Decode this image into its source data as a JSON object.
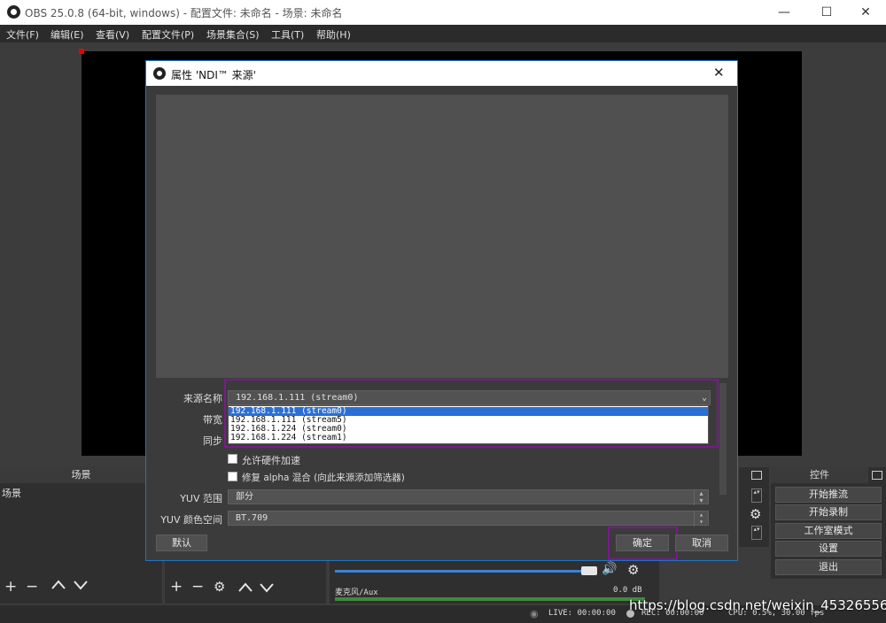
{
  "window": {
    "title": "OBS 25.0.8 (64-bit, windows) - 配置文件: 未命名 - 场景: 未命名",
    "minimize": "—",
    "maximize": "☐",
    "close": "✕"
  },
  "menu": [
    "文件(F)",
    "编辑(E)",
    "查看(V)",
    "配置文件(P)",
    "场景集合(S)",
    "工具(T)",
    "帮助(H)"
  ],
  "scenes_dock": {
    "header": "场景",
    "item": "场景"
  },
  "controls_dock": {
    "header": "控件",
    "buttons": [
      "开始推流",
      "开始录制",
      "工作室模式",
      "设置",
      "退出"
    ]
  },
  "mixer": {
    "track": "麦克风/Aux",
    "level": "0.0 dB"
  },
  "statusbar": {
    "live": "LIVE: 00:00:00",
    "rec": "REC: 00:00:00",
    "cpu": "CPU: 0.5%, 30.00 fps"
  },
  "dialog": {
    "title": "属性 'NDI™ 来源'",
    "close": "✕",
    "source_label": "来源名称",
    "source_value": "192.168.1.111 (stream0)",
    "dropdown_options": [
      "192.168.1.111 (stream0)",
      "192.168.1.111 (stream5)",
      "192.168.1.224 (stream0)",
      "192.168.1.224 (stream1)"
    ],
    "bandwidth_label": "带宽",
    "sync_label": "同步",
    "hw_accel_label": "允许硬件加速",
    "alpha_fix_label": "修复 alpha 混合 (向此来源添加筛选器)",
    "yuv_range_label": "YUV 范围",
    "yuv_range_value": "部分",
    "yuv_space_label": "YUV 颜色空间",
    "yuv_space_value": "BT.709",
    "defaults_button": "默认",
    "ok_button": "确定",
    "cancel_button": "取消"
  },
  "watermark": "https://blog.csdn.net/weixin_45326556",
  "colors": {
    "accent": "#1e74c8",
    "highlight_box": "#7a1a8c",
    "selection": "#2a6fd6"
  }
}
